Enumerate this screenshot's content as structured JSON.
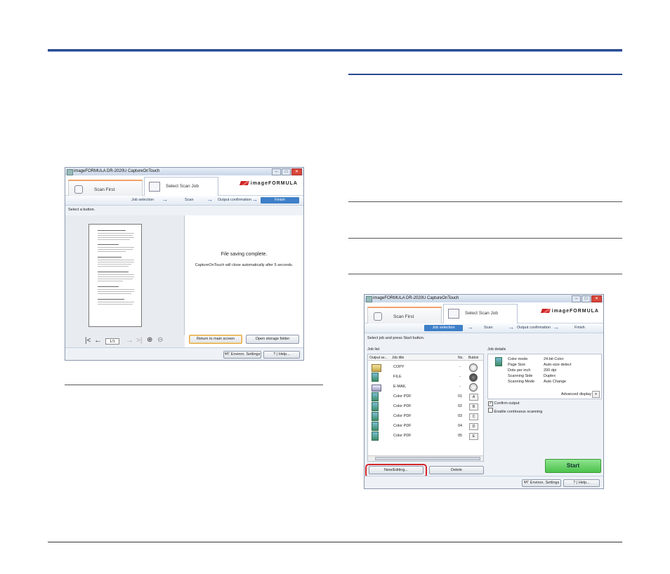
{
  "shot1": {
    "title": "imageFORMULA DR-2020U CaptureOnTouch",
    "tab_scan_first": "Scan First",
    "tab_select_scan_job": "Select Scan Job",
    "logo": "imageFORMULA",
    "steps": [
      "Job selection",
      "Scan",
      "Output confirmation",
      "Finish"
    ],
    "active_step": "Finish",
    "hint": "Select a button.",
    "complete_title": "File saving complete.",
    "complete_msg": "CaptureOnTouch will close automatically after 5 seconds.",
    "return_button": "Return to main screen",
    "open_folder_button": "Open storage folder",
    "page_field": "1/1",
    "environ_settings": "Environ. Settings",
    "help": "Help...",
    "help_q": "?"
  },
  "shot2": {
    "title": "imageFORMULA DR-2020U CaptureOnTouch",
    "tab_scan_first": "Scan First",
    "tab_select_scan_job": "Select Scan Job",
    "logo": "imageFORMULA",
    "steps": [
      "Job selection",
      "Scan",
      "Output confirmation",
      "Finish"
    ],
    "active_step": "Job selection",
    "hint": "Select job and press Start button.",
    "job_list_label": "Job list",
    "columns": [
      "Output se...",
      "Job title",
      "No.",
      "Button"
    ],
    "jobs": [
      {
        "title": "COPY",
        "no": "-",
        "button": ""
      },
      {
        "title": "FILE",
        "no": "-",
        "button": ""
      },
      {
        "title": "E-MAIL",
        "no": "-",
        "button": ""
      },
      {
        "title": "Color PDF",
        "no": "01",
        "button": "A"
      },
      {
        "title": "Color PDF",
        "no": "02",
        "button": "B"
      },
      {
        "title": "Color PDF",
        "no": "03",
        "button": "C"
      },
      {
        "title": "Color PDF",
        "no": "04",
        "button": "D"
      },
      {
        "title": "Color PDF",
        "no": "05",
        "button": "E"
      }
    ],
    "job_details_label": "Job details",
    "details": [
      {
        "key": "Color mode",
        "value": "24-bit Color"
      },
      {
        "key": "Page Size",
        "value": "Auto-size detect"
      },
      {
        "key": "Dots per inch",
        "value": "200 dpi"
      },
      {
        "key": "Scanning Side",
        "value": "Duplex"
      },
      {
        "key": "Scanning Mode",
        "value": "Auto Change"
      }
    ],
    "advanced_display": "Advanced display",
    "confirm_output": "Confirm output",
    "enable_continuous": "Enable continuous scanning",
    "new_editing_button": "New/Editing...",
    "delete_button": "Delete",
    "start_button": "Start",
    "environ_settings": "Environ. Settings",
    "help": "Help...",
    "help_q": "?"
  },
  "colors": {
    "rule_blue": "#1f3f82",
    "active_step": "#3d7fc8",
    "start_green": "#62d262",
    "highlight_red": "#d4262a"
  }
}
